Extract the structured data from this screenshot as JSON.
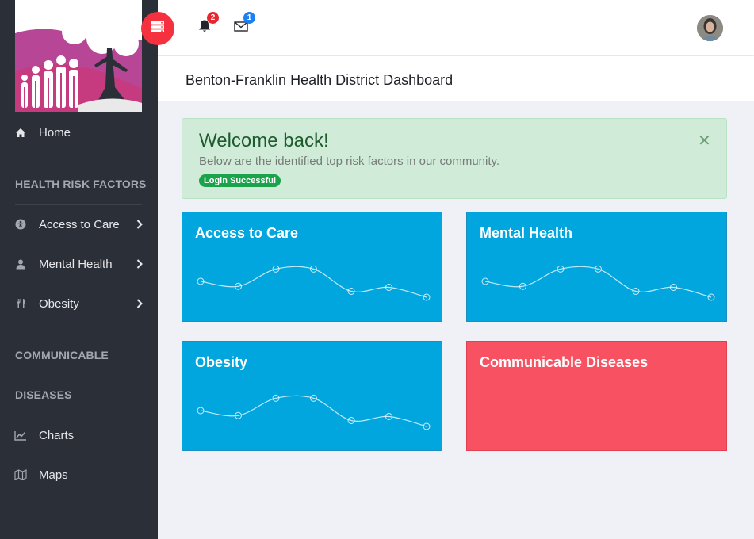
{
  "sidebar": {
    "home_label": "Home",
    "section_risk": "HEALTH RISK FACTORS",
    "risk_items": [
      {
        "label": "Access to Care",
        "icon": "universal-access-icon"
      },
      {
        "label": "Mental Health",
        "icon": "user-icon"
      },
      {
        "label": "Obesity",
        "icon": "cutlery-icon"
      }
    ],
    "section_comm_line1": "COMMUNICABLE",
    "section_comm_line2": "DISEASES",
    "comm_items": [
      {
        "label": "Charts",
        "icon": "line-chart-icon"
      },
      {
        "label": "Maps",
        "icon": "map-icon"
      }
    ]
  },
  "topbar": {
    "notifications_count": "2",
    "messages_count": "1",
    "colors": {
      "notif_badge": "#e8262f",
      "msg_badge": "#1e7ff0",
      "menu_toggle": "#f5303f"
    }
  },
  "page": {
    "title": "Benton-Franklin Health District Dashboard"
  },
  "alert": {
    "heading": "Welcome back!",
    "message": "Below are the identified top risk factors in our community.",
    "badge": "Login Successful",
    "close_symbol": "✕"
  },
  "cards": [
    {
      "title": "Access to Care",
      "color": "#00a6dd",
      "sparkline": true
    },
    {
      "title": "Mental Health",
      "color": "#00a6dd",
      "sparkline": true
    },
    {
      "title": "Obesity",
      "color": "#00a6dd",
      "sparkline": true
    },
    {
      "title": "Communicable Diseases",
      "color": "#f85262",
      "sparkline": false
    }
  ],
  "sparkline_values": [
    4,
    3,
    6.5,
    6.5,
    2,
    2.8,
    0.8
  ]
}
